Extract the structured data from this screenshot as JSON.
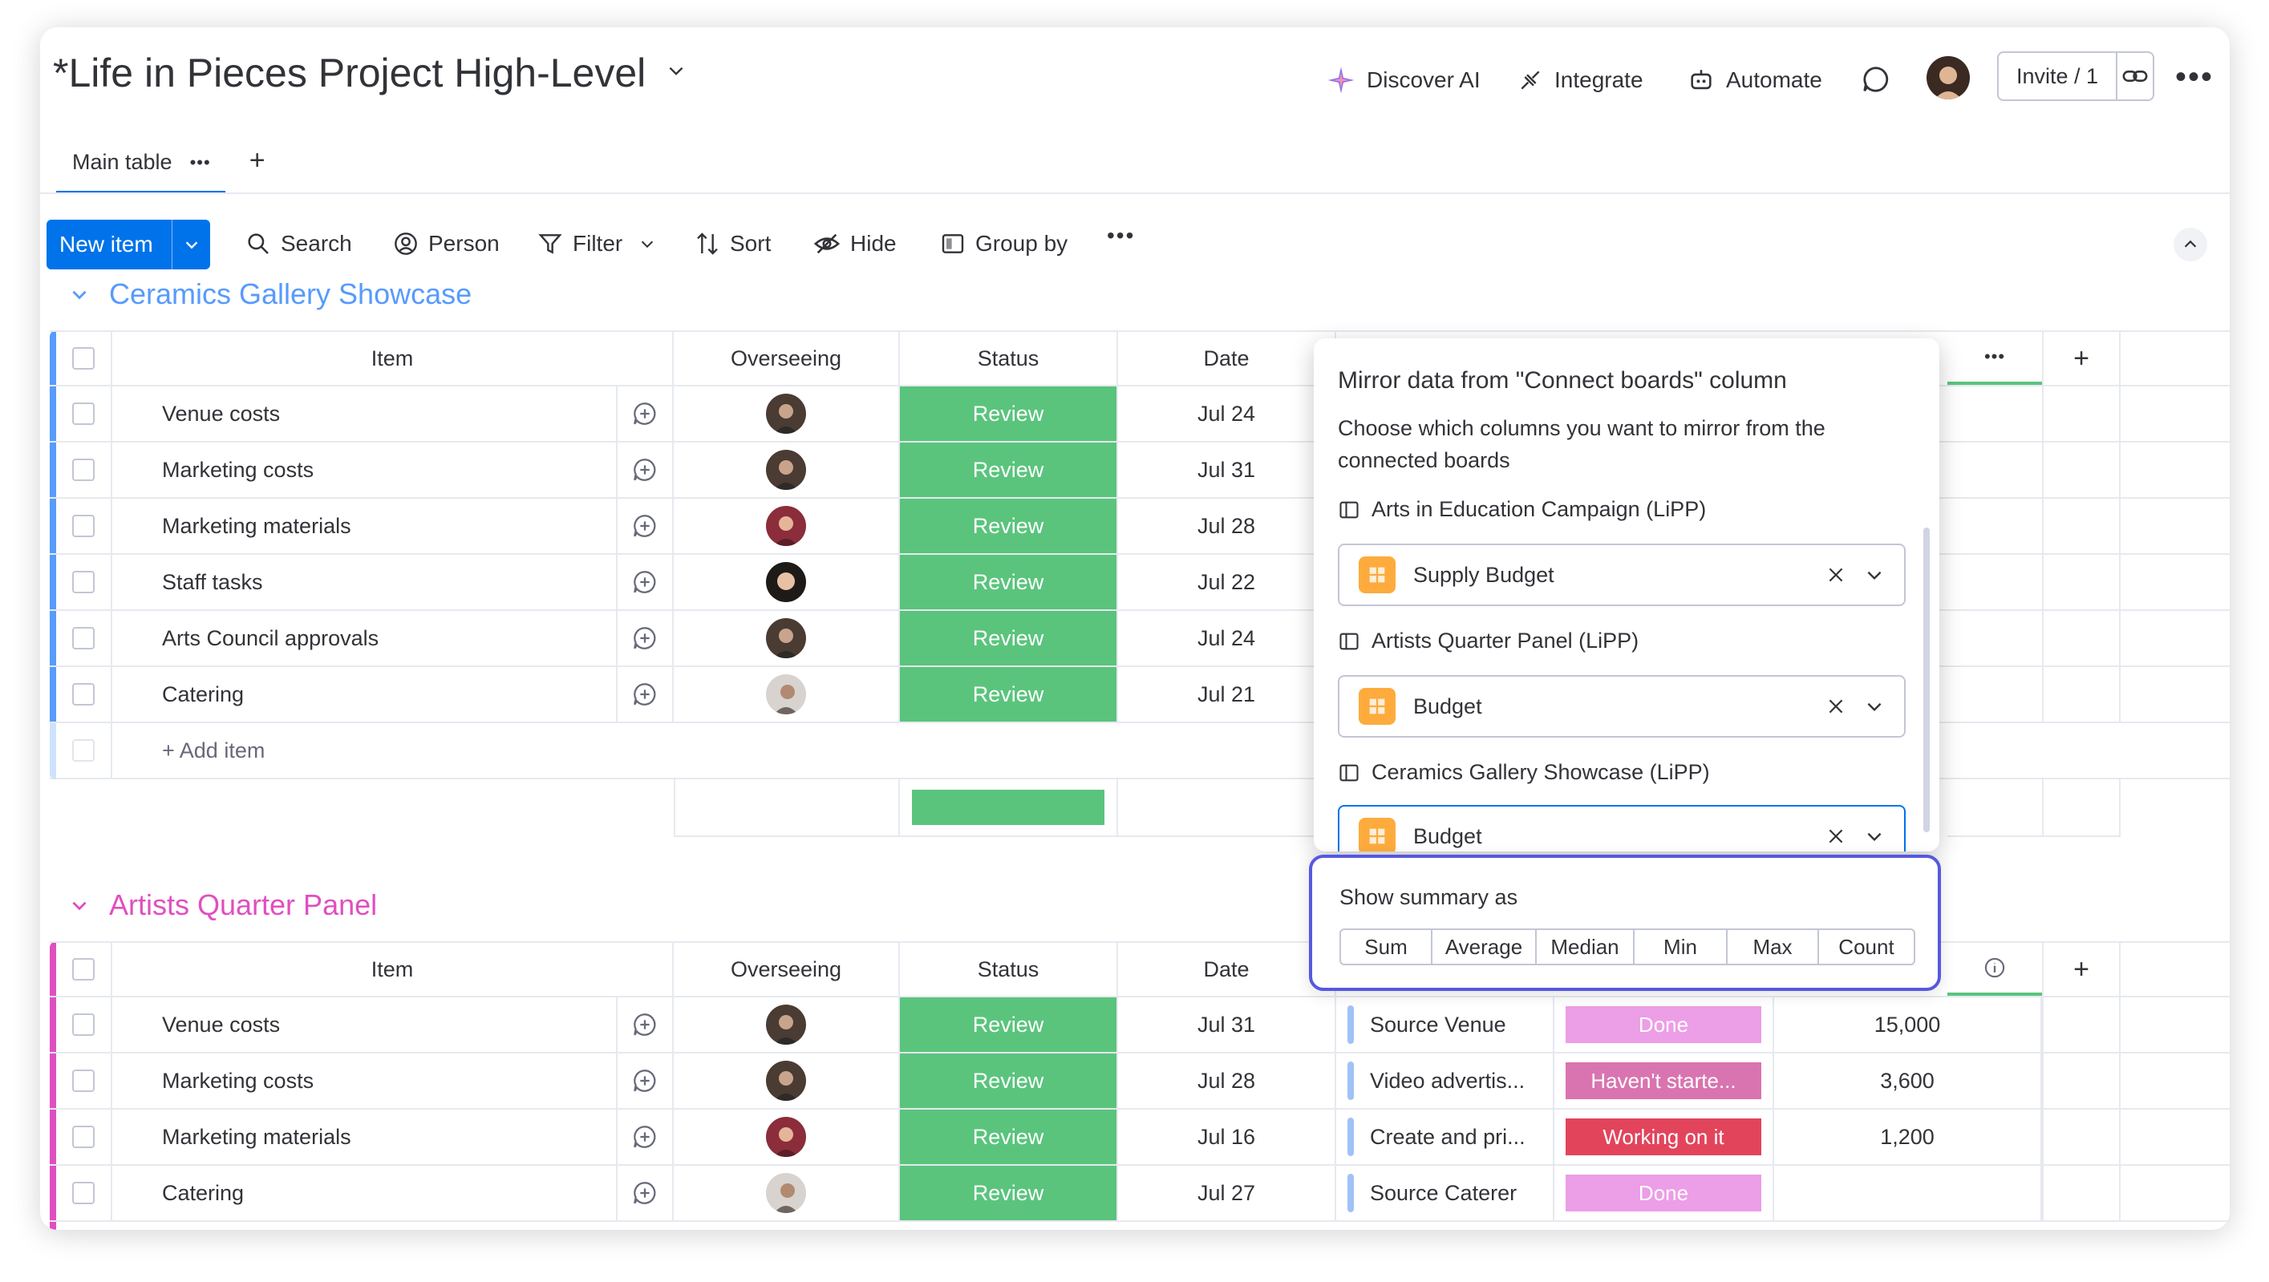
{
  "header": {
    "title": "*Life in Pieces Project High-Level",
    "discover_ai": "Discover AI",
    "integrate": "Integrate",
    "automate": "Automate",
    "invite": "Invite / 1"
  },
  "tabs": {
    "main": "Main table"
  },
  "toolbar": {
    "new_item": "New item",
    "search": "Search",
    "person": "Person",
    "filter": "Filter",
    "sort": "Sort",
    "hide": "Hide",
    "group_by": "Group by"
  },
  "columns": {
    "item": "Item",
    "overseeing": "Overseeing",
    "status": "Status",
    "date": "Date"
  },
  "groups": [
    {
      "title": "Ceramics Gallery Showcase",
      "color": "#579bfc",
      "add_item": "+ Add item",
      "rows": [
        {
          "item": "Venue costs",
          "status": "Review",
          "date": "Jul 24"
        },
        {
          "item": "Marketing costs",
          "status": "Review",
          "date": "Jul 31"
        },
        {
          "item": "Marketing materials",
          "status": "Review",
          "date": "Jul 28"
        },
        {
          "item": "Staff tasks",
          "status": "Review",
          "date": "Jul 22"
        },
        {
          "item": "Arts Council approvals",
          "status": "Review",
          "date": "Jul 24"
        },
        {
          "item": "Catering",
          "status": "Review",
          "date": "Jul 21"
        }
      ]
    },
    {
      "title": "Artists Quarter Panel",
      "color": "#e2445c",
      "rows": [
        {
          "item": "Venue costs",
          "status": "Review",
          "date": "Jul 31",
          "dependency": "Source Venue",
          "status2": "Done",
          "budget": "15,000"
        },
        {
          "item": "Marketing costs",
          "status": "Review",
          "date": "Jul 28",
          "dependency": "Video advertis...",
          "status2": "Haven't starte...",
          "budget": "3,600"
        },
        {
          "item": "Marketing materials",
          "status": "Review",
          "date": "Jul 16",
          "dependency": "Create and pri...",
          "status2": "Working on it",
          "budget": "1,200"
        },
        {
          "item": "Catering",
          "status": "Review",
          "date": "Jul 27",
          "dependency": "Source Caterer",
          "status2": "Done",
          "budget": ""
        }
      ]
    }
  ],
  "popup": {
    "title": "Mirror data from \"Connect boards\" column",
    "subtitle": "Choose which columns you want to mirror from the connected boards",
    "sections": [
      {
        "board": "Arts in Education Campaign (LiPP)",
        "column": "Supply Budget"
      },
      {
        "board": "Artists Quarter Panel (LiPP)",
        "column": "Budget"
      },
      {
        "board": "Ceramics Gallery Showcase (LiPP)",
        "column": "Budget"
      }
    ]
  },
  "summary": {
    "label": "Show summary as",
    "options": [
      "Sum",
      "Average",
      "Median",
      "Min",
      "Max",
      "Count"
    ]
  },
  "colors": {
    "accent": "#0073ea",
    "review_green": "#5ac47d",
    "done_pink": "#ec9ee6",
    "havent_started_pink": "#d974b0",
    "working_on_it": "#e2445c",
    "highlight_border": "#5559df"
  }
}
